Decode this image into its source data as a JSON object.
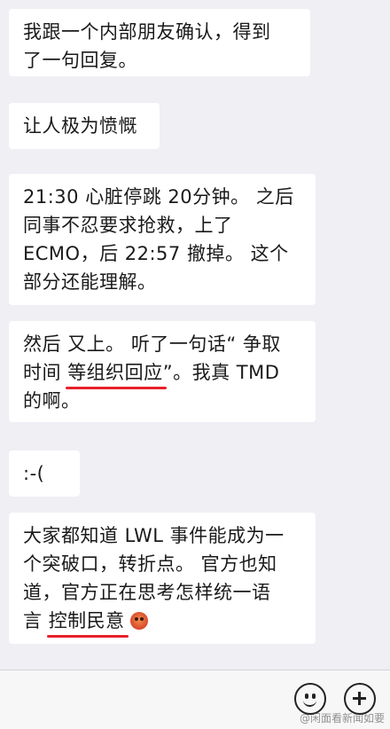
{
  "messages": [
    {
      "lines": [
        "我跟一个内部朋友确认，得到",
        "了一句回复。"
      ]
    },
    {
      "lines": [
        "让人极为愤慨"
      ]
    },
    {
      "lines": [
        "21:30 心脏停跳 20分钟。 之后",
        "同事不忍要求抢救，上了",
        "ECMO，后 22:57 撤掉。 这个",
        "部分还能理解。"
      ]
    },
    {
      "line1": "然后 又上。 听了一句话“ 争取",
      "line2_before": "时间 ",
      "line2_underlined": "等组织回应",
      "line2_after": "”。我真 TMD",
      "line3": "的啊。"
    },
    {
      "lines": [
        ":-("
      ]
    },
    {
      "line1": "大家都知道 LWL 事件能成为一",
      "line2": "个突破口，转折点。 官方也知",
      "line3": "道，官方正在思考怎样统一语",
      "line4_before": "言 ",
      "line4_underlined": "控制民意",
      "emoji": "angry-face"
    }
  ],
  "watermark": "@闲面看新闻如要",
  "colors": {
    "background": "#efeff4",
    "bubble": "#ffffff",
    "underline": "#e8202a"
  }
}
